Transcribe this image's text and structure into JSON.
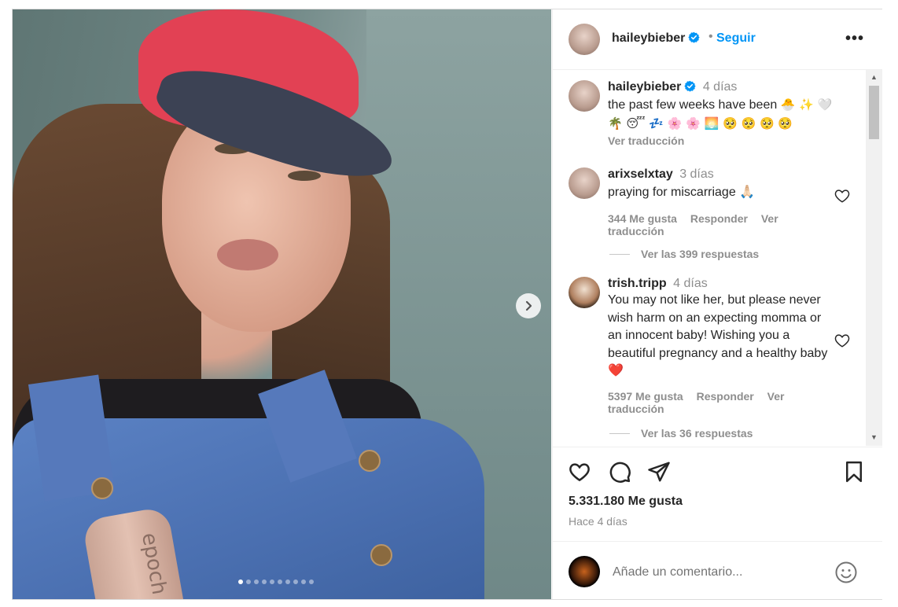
{
  "post": {
    "author": "haileybieber",
    "follow_label": "Seguir",
    "dot": "•",
    "more_label": "•••",
    "image_dots_total": 10,
    "image_dots_active": 0,
    "product_label": "epoch"
  },
  "caption": {
    "username": "haileybieber",
    "ago": "4 días",
    "text": "the past few weeks have been",
    "emojis_line1": "🐣 ✨ 🤍",
    "emojis_line2": "🌴 😴 💤 🌸 🌸 🌅 🥺 🥺 🥺 🥺",
    "translate": "Ver traducción"
  },
  "comments": [
    {
      "username": "arixselxtay",
      "ago": "3 días",
      "text": "praying for miscarriage 🙏🏻",
      "likes": "344 Me gusta",
      "reply": "Responder",
      "translate": "Ver traducción",
      "replies": "Ver las 399 respuestas"
    },
    {
      "username": "trish.tripp",
      "ago": "4 días",
      "text": "You may not like her, but please never wish harm on an expecting momma or an innocent baby! Wishing you a beautiful pregnancy and a healthy baby ❤️",
      "likes": "5397 Me gusta",
      "reply": "Responder",
      "translate": "Ver traducción",
      "replies": "Ver las 36 respuestas"
    }
  ],
  "stats": {
    "likes": "5.331.180 Me gusta",
    "when": "Hace 4 días"
  },
  "add_comment": {
    "placeholder": "Añade un comentario..."
  },
  "icons": {
    "verified_color": "#0095f6",
    "heart_color": "#e0245e",
    "follow_color": "#0095f6"
  }
}
